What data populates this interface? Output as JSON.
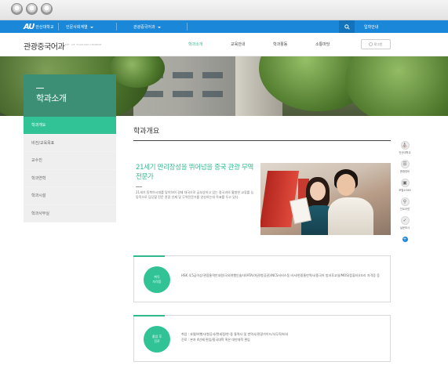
{
  "topbar": {
    "logo": "AU",
    "university": "안산대학교",
    "menu1": "인문사회계열",
    "menu2": "관광중국어과",
    "admission": "입학안내",
    "search_icon": "search-icon"
  },
  "nav": {
    "dept_title": "관광중국어과",
    "dept_en": "DEPT. OF TOURISM CHINESE",
    "items": [
      "학과소개",
      "교육안내",
      "학과활동",
      "소통마당"
    ],
    "login": "로그인"
  },
  "hero": {
    "title": "학과소개"
  },
  "lnb": {
    "items": [
      "학과개요",
      "비전/교육목표",
      "교수진",
      "학과연혁",
      "학과시설",
      "학과사무실"
    ]
  },
  "content": {
    "page_title": "학과개요",
    "intro_title": "21세기 만리장성을 뛰어넘을 중국 관광 무역전문가",
    "intro_text": "21세기 동북아시대를 맞이하여 경제 대국으로 급부상하고 있는 중국과의 활발한 교류를 능동적으로 담당할 전문 관광 인재 및 무역전문가를 양성하는데 목표를 두고 있다.",
    "box1": {
      "label_line1": "취득",
      "label_line2": "자격증",
      "text": "HSK 4,5급이상/관광통역안내원/국외여행인솔자/IATA(여권/항공권)/NCS서비스동 비서/한중통번역사/중국어 방과후교실/MOS(컴퓨터)/조리 자격증 등"
    },
    "box2": {
      "label_line1": "졸업 후",
      "label_line2": "진로",
      "text_line1": "취업 : 호텔/여행사/항공사/면세점/한-중 통역사 및 번역사/관광가이드/사무직/비서",
      "text_line2": "진로 : 본과 4년제 편입/중국대학 혹은 대만대학 편입"
    }
  },
  "quick": {
    "items": [
      "안산대학교",
      "종합정보",
      "포털소365",
      "인트라넷",
      "설문조사"
    ],
    "more": "+"
  }
}
